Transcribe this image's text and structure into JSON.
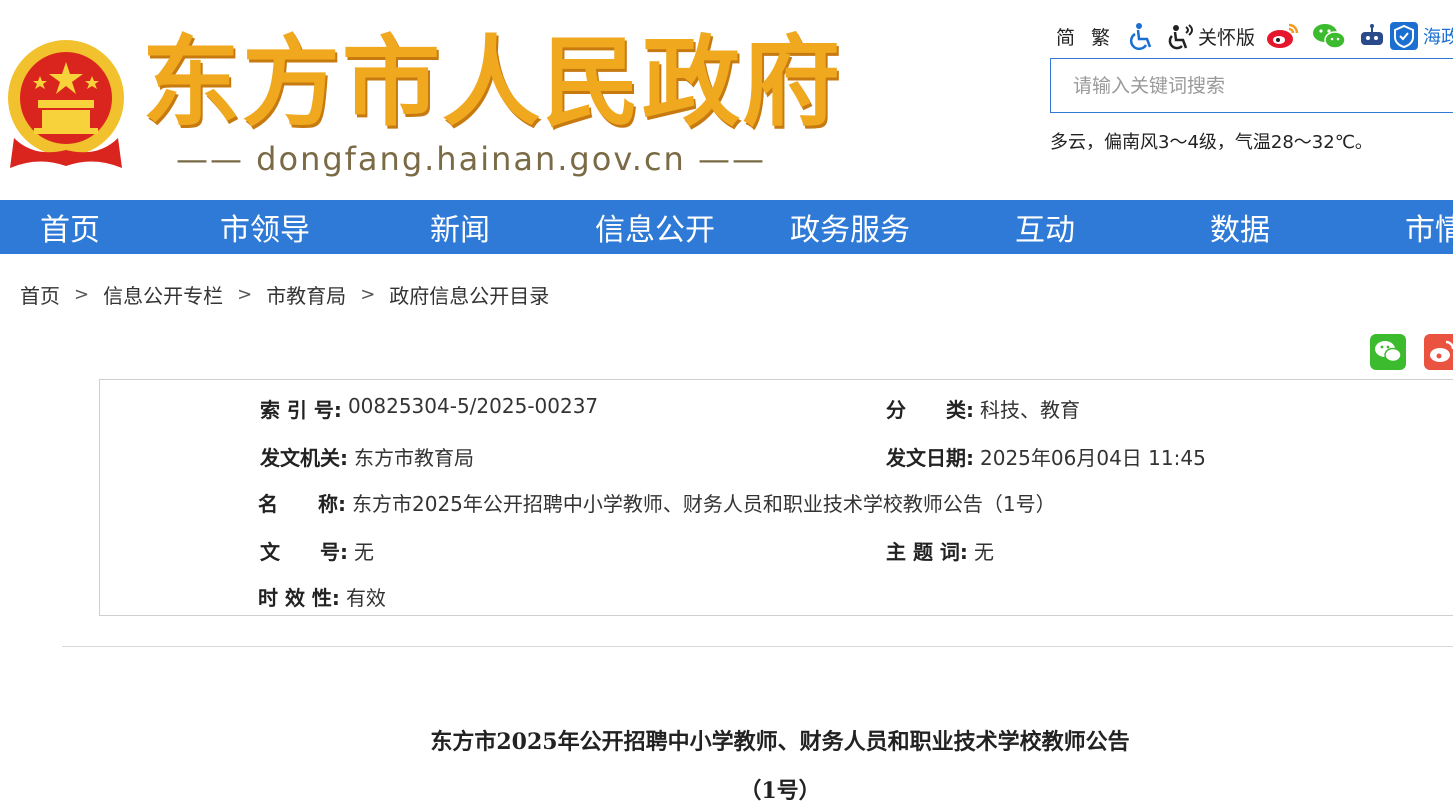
{
  "header": {
    "site_title": "东方市人民政府",
    "site_domain": "—— dongfang.hainan.gov.cn ——",
    "tools": {
      "simplified": "简",
      "traditional": "繁",
      "care_mode": "关怀版",
      "hainan_app": "海政通"
    },
    "search_placeholder": "请输入关键词搜索",
    "weather": "多云，偏南风3～4级，气温28～32℃。"
  },
  "nav": {
    "items": [
      "首页",
      "市领导",
      "新闻",
      "信息公开",
      "政务服务",
      "互动",
      "数据",
      "市情"
    ]
  },
  "breadcrumb": {
    "items": [
      "首页",
      "信息公开专栏",
      "市教育局",
      "政府信息公开目录"
    ],
    "separator": ">"
  },
  "meta": {
    "index_label": "索 引 号:",
    "index_value": "00825304-5/2025-00237",
    "category_label": "分　　类:",
    "category_value": "科技、教育",
    "issuer_label": "发文机关:",
    "issuer_value": "东方市教育局",
    "date_label": "发文日期:",
    "date_value": "2025年06月04日 11:45",
    "name_label": "名　　称:",
    "name_value": "东方市2025年公开招聘中小学教师、财务人员和职业技术学校教师公告（1号）",
    "docno_label": "文　　号:",
    "docno_value": "无",
    "subject_label": "主 题 词:",
    "subject_value": "无",
    "validity_label": "时 效 性:",
    "validity_value": "有效"
  },
  "article": {
    "title": "东方市2025年公开招聘中小学教师、财务人员和职业技术学校教师公告",
    "subtitle": "（1号）"
  },
  "colors": {
    "nav_blue": "#2f7ad6",
    "title_gold": "#f0a81e",
    "emblem_red": "#d9251d"
  }
}
